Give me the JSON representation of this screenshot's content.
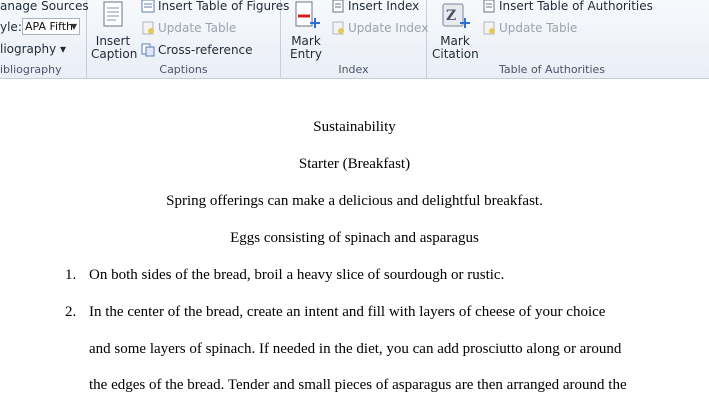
{
  "ribbon": {
    "bibliography": {
      "manage_sources": "anage Sources",
      "style_label": "yle:",
      "style_value": "APA Fifth",
      "bibliography_btn": "liography ▾",
      "group_label": "ibliography"
    },
    "captions": {
      "insert_caption_line1": "Insert",
      "insert_caption_line2": "Caption",
      "insert_table_of_figures": "Insert Table of Figures",
      "update_table": "Update Table",
      "cross_reference": "Cross-reference",
      "group_label": "Captions"
    },
    "index": {
      "mark_entry_line1": "Mark",
      "mark_entry_line2": "Entry",
      "insert_index": "Insert Index",
      "update_index": "Update Index",
      "group_label": "Index"
    },
    "authorities": {
      "mark_citation_line1": "Mark",
      "mark_citation_line2": "Citation",
      "insert_table_of_authorities": "Insert Table of Authorities",
      "update_table": "Update Table",
      "group_label": "Table of Authorities"
    }
  },
  "document": {
    "title": "Sustainability",
    "subtitle": "Starter (Breakfast)",
    "intro": "Spring offerings can make a delicious and delightful breakfast.",
    "dish": "Eggs consisting of spinach and asparagus",
    "list": [
      {
        "num": "1.",
        "lines": [
          "On both sides of the bread, broil  a heavy slice of sourdough or rustic."
        ]
      },
      {
        "num": "2.",
        "lines": [
          "In the center of the bread, create an intent and fill with layers  of cheese of your choice",
          "and some layers of spinach.  If needed in the diet, you can add prosciutto along or around",
          "the edges of the bread. Tender and small pieces of asparagus are then arranged around the"
        ]
      }
    ]
  }
}
